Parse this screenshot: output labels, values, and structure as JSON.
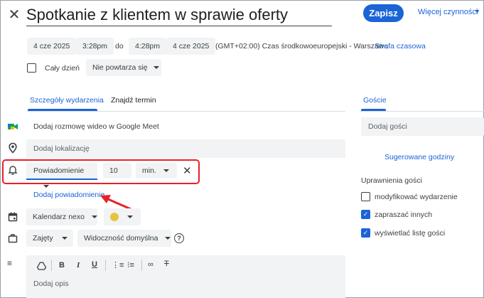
{
  "header": {
    "title": "Spotkanie z klientem w sprawie oferty",
    "save_label": "Zapisz",
    "more_actions_label": "Więcej czynności"
  },
  "datetime": {
    "start_date": "4 cze 2025",
    "start_time": "3:28pm",
    "separator": "do",
    "end_time": "4:28pm",
    "end_date": "4 cze 2025",
    "timezone": "(GMT+02:00) Czas środkowoeuropejski - Warszawa",
    "timezone_link": "Strefa czasowa",
    "all_day_label": "Cały dzień",
    "all_day_checked": false,
    "repeat_value": "Nie powtarza się"
  },
  "tabs": {
    "details": "Szczegóły wydarzenia",
    "find_time": "Znajdź termin",
    "guests": "Goście"
  },
  "details": {
    "meet_label": "Dodaj rozmowę wideo w Google Meet",
    "location_placeholder": "Dodaj lokalizację",
    "notification": {
      "type": "Powiadomienie",
      "amount": "10",
      "unit": "min."
    },
    "add_notification_label": "Dodaj powiadomienie",
    "calendar_name": "Kalendarz nexo",
    "event_color": "#e4c441",
    "status": "Zajęty",
    "visibility": "Widoczność domyślna",
    "description_placeholder": "Dodaj opis"
  },
  "guests": {
    "add_placeholder": "Dodaj gości",
    "suggested_times": "Sugerowane godziny",
    "permissions_title": "Uprawnienia gości",
    "permissions": [
      {
        "label": "modyfikować wydarzenie",
        "checked": false
      },
      {
        "label": "zapraszać innych",
        "checked": true
      },
      {
        "label": "wyświetlać listę gości",
        "checked": true
      }
    ]
  },
  "colors": {
    "accent": "#1a64d6",
    "highlight_box": "#e8202a",
    "meet_green": "#00a35a",
    "meet_blue": "#1a73e8",
    "meet_yellow": "#fbbc04"
  }
}
